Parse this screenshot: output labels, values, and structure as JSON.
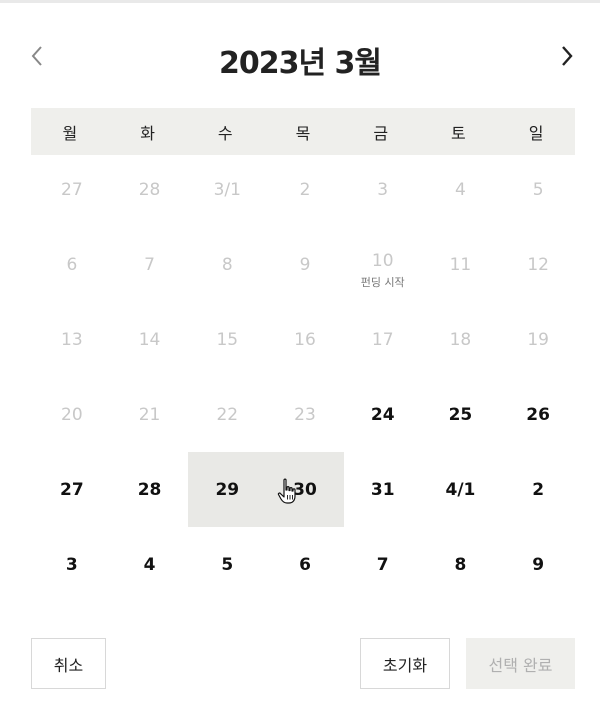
{
  "header": {
    "title": "2023년 3월",
    "prev_icon": "chevron-left-icon",
    "next_icon": "chevron-right-icon"
  },
  "weekdays": [
    "월",
    "화",
    "수",
    "목",
    "금",
    "토",
    "일"
  ],
  "days": [
    {
      "label": "27",
      "state": "disabled"
    },
    {
      "label": "28",
      "state": "disabled"
    },
    {
      "label": "3/1",
      "state": "disabled"
    },
    {
      "label": "2",
      "state": "disabled"
    },
    {
      "label": "3",
      "state": "disabled"
    },
    {
      "label": "4",
      "state": "disabled"
    },
    {
      "label": "5",
      "state": "disabled"
    },
    {
      "label": "6",
      "state": "disabled"
    },
    {
      "label": "7",
      "state": "disabled"
    },
    {
      "label": "8",
      "state": "disabled"
    },
    {
      "label": "9",
      "state": "disabled"
    },
    {
      "label": "10",
      "state": "disabled",
      "sub": "펀딩 시작"
    },
    {
      "label": "11",
      "state": "disabled"
    },
    {
      "label": "12",
      "state": "disabled"
    },
    {
      "label": "13",
      "state": "disabled"
    },
    {
      "label": "14",
      "state": "disabled"
    },
    {
      "label": "15",
      "state": "disabled"
    },
    {
      "label": "16",
      "state": "disabled"
    },
    {
      "label": "17",
      "state": "disabled"
    },
    {
      "label": "18",
      "state": "disabled"
    },
    {
      "label": "19",
      "state": "disabled"
    },
    {
      "label": "20",
      "state": "disabled"
    },
    {
      "label": "21",
      "state": "disabled"
    },
    {
      "label": "22",
      "state": "disabled"
    },
    {
      "label": "23",
      "state": "disabled"
    },
    {
      "label": "24",
      "state": "active"
    },
    {
      "label": "25",
      "state": "active"
    },
    {
      "label": "26",
      "state": "active"
    },
    {
      "label": "27",
      "state": "active"
    },
    {
      "label": "28",
      "state": "active"
    },
    {
      "label": "29",
      "state": "active",
      "selected": true
    },
    {
      "label": "30",
      "state": "active",
      "selected": true
    },
    {
      "label": "31",
      "state": "active"
    },
    {
      "label": "4/1",
      "state": "active"
    },
    {
      "label": "2",
      "state": "active"
    },
    {
      "label": "3",
      "state": "active"
    },
    {
      "label": "4",
      "state": "active"
    },
    {
      "label": "5",
      "state": "active"
    },
    {
      "label": "6",
      "state": "active"
    },
    {
      "label": "7",
      "state": "active"
    },
    {
      "label": "8",
      "state": "active"
    },
    {
      "label": "9",
      "state": "active"
    }
  ],
  "footer": {
    "cancel_label": "취소",
    "reset_label": "초기화",
    "confirm_label": "선택 완료"
  },
  "colors": {
    "header_bar": "#efefec",
    "selected_range": "#e9e9e6",
    "disabled_text": "#c8c8c8"
  },
  "cursor_icon": "hand-pointer-icon"
}
